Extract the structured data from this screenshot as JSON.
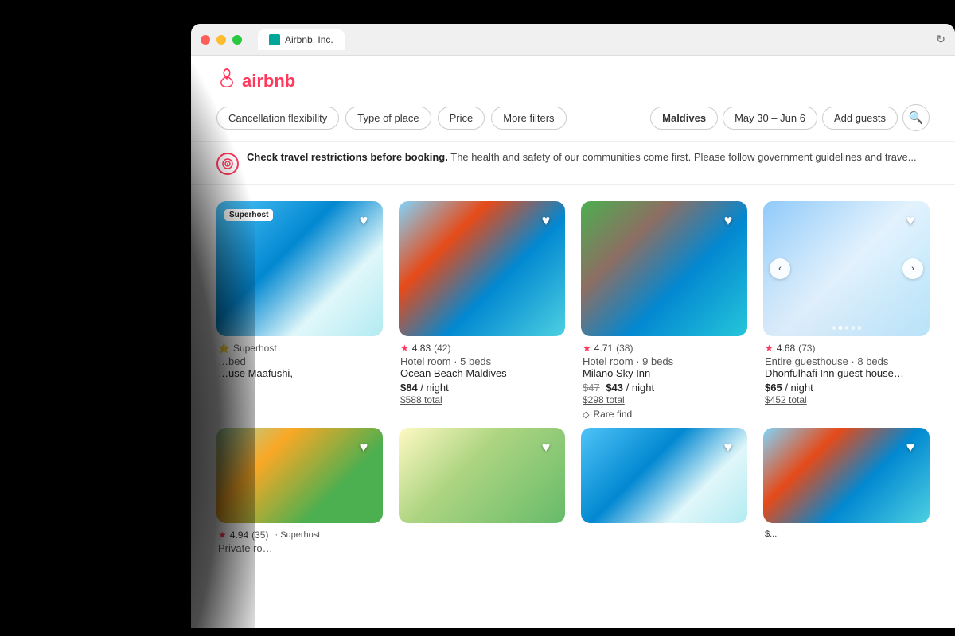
{
  "browser": {
    "tab_label": "Airbnb, Inc.",
    "dots": [
      "red",
      "yellow",
      "green"
    ]
  },
  "header": {
    "logo_text": "airbnb",
    "logo_symbol": "♠"
  },
  "filters": {
    "pills": [
      {
        "id": "cancellation",
        "label": "Cancellation flexibility"
      },
      {
        "id": "type",
        "label": "Type of place"
      },
      {
        "id": "price",
        "label": "Price"
      },
      {
        "id": "more",
        "label": "More filters"
      }
    ],
    "search_pills": [
      {
        "id": "location",
        "label": "Maldives"
      },
      {
        "id": "dates",
        "label": "May 30 – Jun 6"
      },
      {
        "id": "guests",
        "label": "Add guests"
      }
    ],
    "search_icon": "🔍"
  },
  "warning": {
    "icon": "◎",
    "text_bold": "Check travel restrictions before booking.",
    "text_rest": " The health and safety of our communities come first. Please follow government guidelines and trave..."
  },
  "listings": [
    {
      "id": 1,
      "superhost": true,
      "superhost_label": "Superhost",
      "truncated_name": "…use Maafushi,",
      "type": "",
      "rating": "4.83",
      "review_count": "42",
      "listing_type": "Hotel room · 5 beds",
      "name": "Ocean Beach Maldives",
      "price_per_night": "$84",
      "price_total": "$588 total",
      "image_class": "img-beach2",
      "has_dots": false
    },
    {
      "id": 2,
      "rating": "4.71",
      "review_count": "38",
      "listing_type": "Hotel room · 9 beds",
      "name": "Milano Sky Inn",
      "price_original": "$47",
      "price_per_night": "$43",
      "price_total": "$298 total",
      "rare_find": true,
      "rare_find_label": "Rare find",
      "image_class": "img-beach3",
      "has_dots": false
    },
    {
      "id": 3,
      "rating": "4.68",
      "review_count": "73",
      "listing_type": "Entire guesthouse · 8 beds",
      "name": "Dhonfulhafi Inn guest house…",
      "price_per_night": "$65",
      "price_total": "$452 total",
      "image_class": "img-beach4",
      "has_dots": true,
      "partial": false
    },
    {
      "id": 4,
      "partial": true,
      "rating": "",
      "image_class": "img-beach4",
      "has_dots": false
    }
  ],
  "listings_row2": [
    {
      "id": 5,
      "rating": "4.94",
      "review_count": "35",
      "superhost": true,
      "listing_type": "Private ro…",
      "name": "",
      "image_class": "img-villa",
      "has_dots": false,
      "partial_bottom": true
    },
    {
      "id": 6,
      "image_class": "img-resort",
      "partial_bottom": true,
      "has_dots": false
    },
    {
      "id": 7,
      "image_class": "img-beach1",
      "partial_bottom": true,
      "has_dots": false
    },
    {
      "id": 8,
      "image_class": "img-beach2",
      "partial_bottom": true,
      "has_dots": false
    }
  ]
}
